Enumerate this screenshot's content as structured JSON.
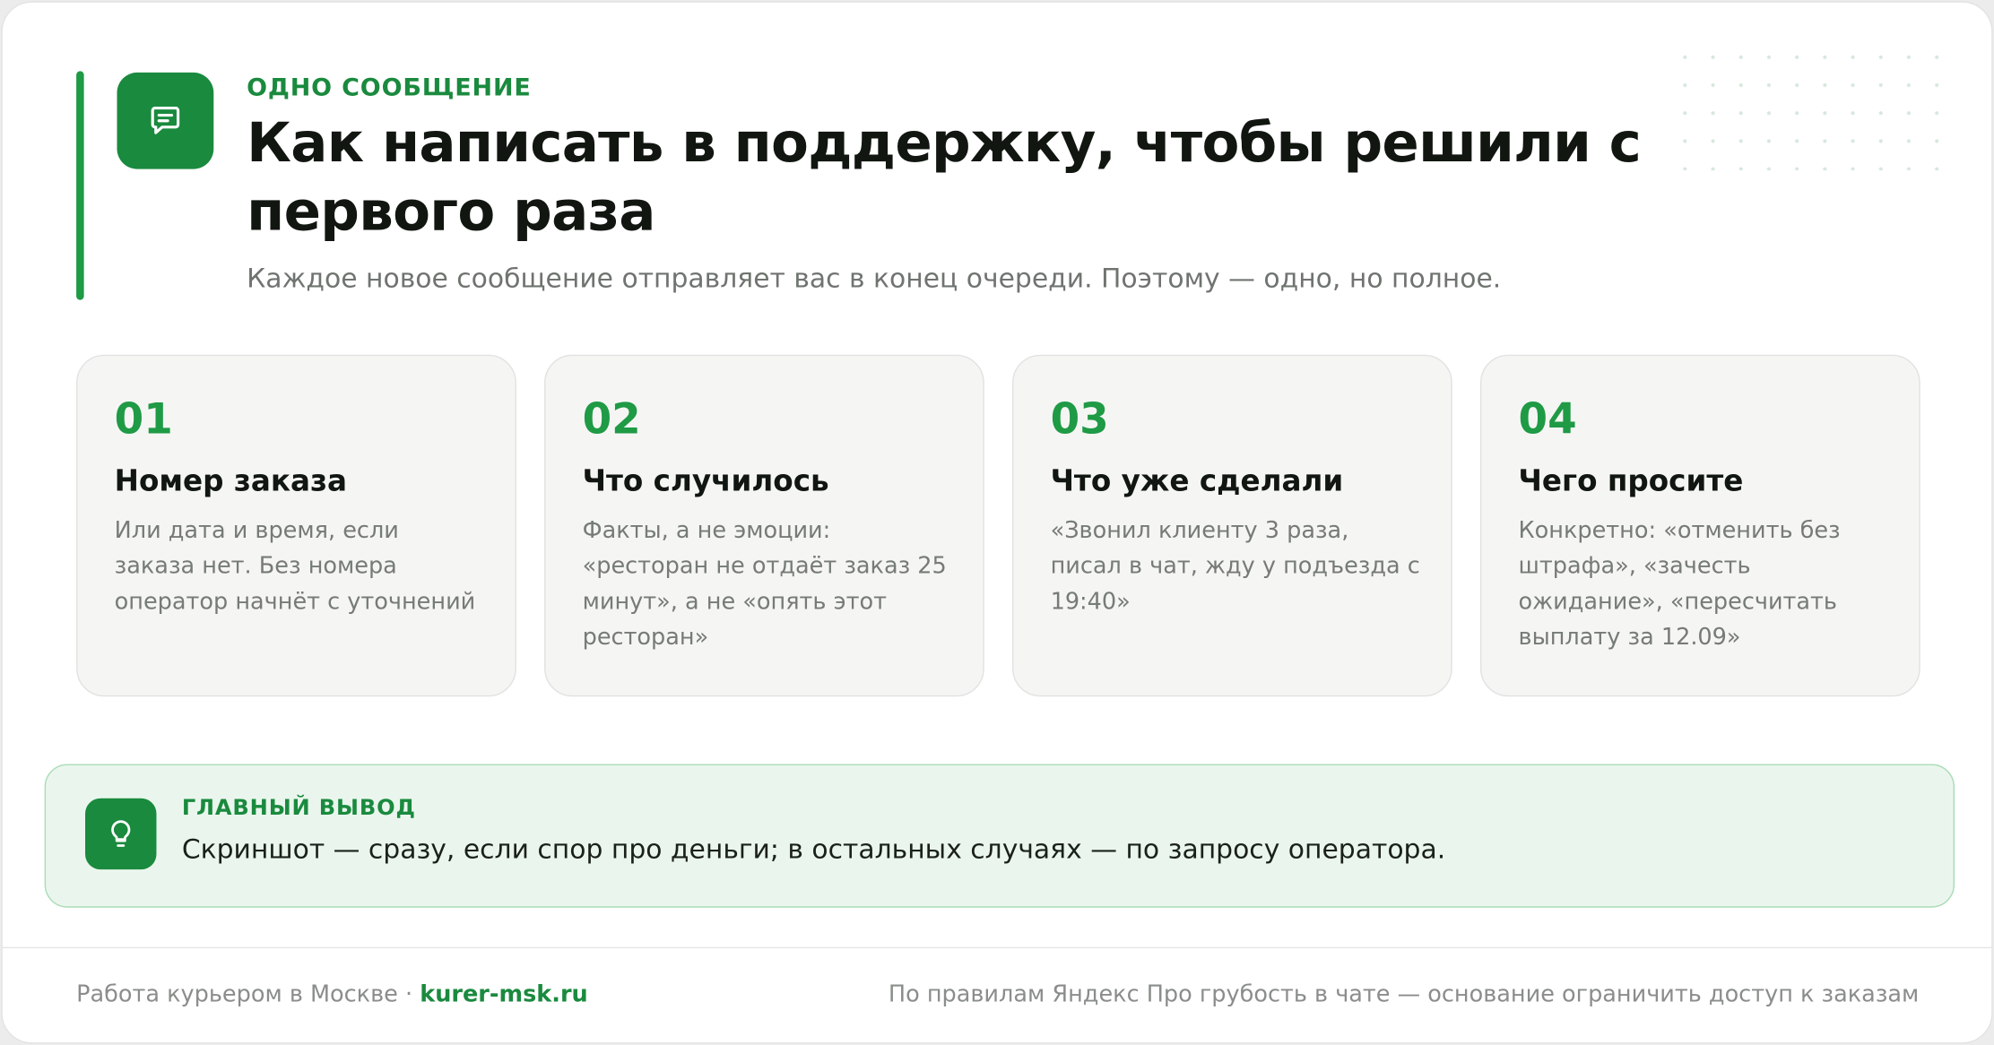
{
  "header": {
    "eyebrow": "ОДНО СООБЩЕНИЕ",
    "title": "Как написать в поддержку, чтобы решили с первого раза",
    "subtitle": "Каждое новое сообщение отправляет вас в конец очереди. Поэтому — одно, но полное.",
    "icon": "chat-message-icon"
  },
  "steps": [
    {
      "number": "01",
      "title": "Номер заказа",
      "text": "Или дата и время, если заказа нет. Без номера оператор начнёт с уточнений"
    },
    {
      "number": "02",
      "title": "Что случилось",
      "text": "Факты, а не эмоции: «ресторан не отдаёт заказ 25 минут», а не «опять этот ресторан»"
    },
    {
      "number": "03",
      "title": "Что уже сделали",
      "text": "«Звонил клиенту 3 раза, писал в чат, жду у подъезда с 19:40»"
    },
    {
      "number": "04",
      "title": "Чего просите",
      "text": "Конкретно: «отменить без штрафа», «зачесть ожидание», «пересчитать выплату за 12.09»"
    }
  ],
  "summary": {
    "label": "ГЛАВНЫЙ ВЫВОД",
    "text": "Скриншот — сразу, если спор про деньги; в остальных случаях — по запросу оператора.",
    "icon": "lightbulb-icon"
  },
  "footer": {
    "left_text": "Работа курьером в Москве ·",
    "link_text": "kurer-msk.ru",
    "right_text": "По правилам Яндекс Про грубость в чате — основание ограничить доступ к заказам"
  },
  "colors": {
    "accent": "#1f9a45",
    "accent_dark": "#1a8a3e",
    "card_bg": "#f5f6f4",
    "summary_bg": "#eaf6ed"
  }
}
